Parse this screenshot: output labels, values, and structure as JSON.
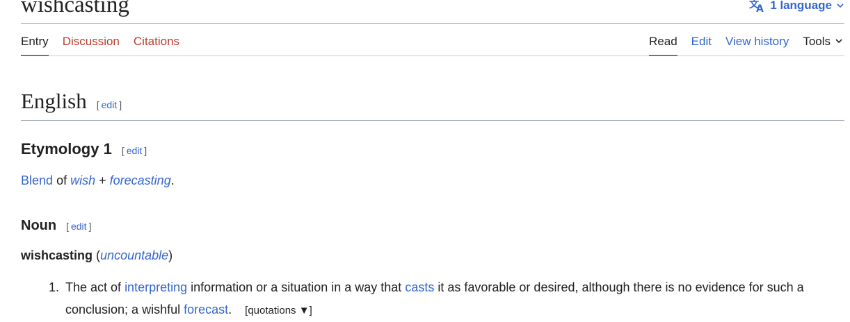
{
  "page": {
    "title": "wishcasting",
    "language_button": "1 language"
  },
  "tabs_left": [
    {
      "label": "Entry"
    },
    {
      "label": "Discussion"
    },
    {
      "label": "Citations"
    }
  ],
  "tabs_right": [
    {
      "label": "Read"
    },
    {
      "label": "Edit"
    },
    {
      "label": "View history"
    },
    {
      "label": "Tools"
    }
  ],
  "edit_link": {
    "open": "[",
    "label": "edit",
    "close": "]"
  },
  "sections": {
    "english": "English",
    "etymology": "Etymology 1",
    "noun": "Noun"
  },
  "etymology": {
    "blend": "Blend",
    "of": "of",
    "wish": "wish",
    "plus": "+",
    "forecasting": "forecasting",
    "period": "."
  },
  "headword": {
    "word": "wishcasting",
    "open_paren": "(",
    "label": "uncountable",
    "close_paren": ")"
  },
  "definitions": [
    {
      "number": "1.",
      "part1": "The act of",
      "link1": "interpreting",
      "part2": "information or a situation in a way that",
      "link2": "casts",
      "part3": "it as favorable or desired, although there is no evidence for such a conclusion; a wishful",
      "link3": "forecast",
      "part4": ".",
      "quotations": "[quotations ▼]"
    }
  ],
  "colors": {
    "link": "#3366cc",
    "red_link": "#bf3c2c",
    "text": "#202122",
    "rule": "#a2a9b1"
  },
  "icons": {
    "language": "translate-icon",
    "dropdown": "chevron-down-icon"
  }
}
